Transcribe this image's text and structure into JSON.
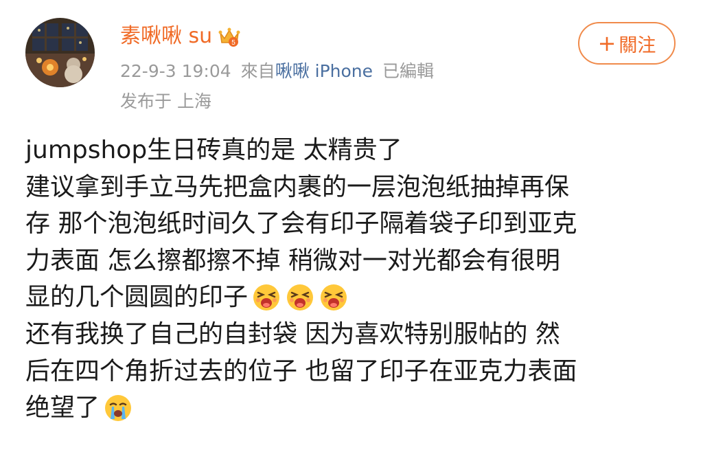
{
  "header": {
    "username": "素啾啾 su",
    "badge_icon": "crown-badge-icon",
    "date": "22-9-3 19:04",
    "source_prefix": "來自",
    "source_name": "啾啾 iPhone",
    "edited_label": "已編輯",
    "location_label": "发布于 上海",
    "follow_plus": "+",
    "follow_label": "關注"
  },
  "colors": {
    "username": "#f06a26",
    "source_link": "#4a6fa0",
    "meta": "#9a9a9a",
    "follow_border": "#f08a4a",
    "body_text": "#1a1a1a"
  },
  "post": {
    "lines": [
      "jumpshop生日砖真的是 太精贵了",
      "建议拿到手立马先把盒内裹的一层泡泡纸抽掉再保",
      "存 那个泡泡纸时间久了会有印子隔着袋子印到亚克",
      "力表面 怎么擦都擦不掉 稍微对一对光都会有很明",
      "显的几个圆圆的印子",
      "还有我换了自己的自封袋 因为喜欢特别服帖的 然",
      "后在四个角折过去的位子 也留了印子在亚克力表面",
      "绝望了"
    ],
    "emojis": {
      "line_5": [
        "screaming-face-icon",
        "screaming-face-icon",
        "screaming-face-icon"
      ],
      "line_8": [
        "crying-face-icon"
      ]
    }
  }
}
